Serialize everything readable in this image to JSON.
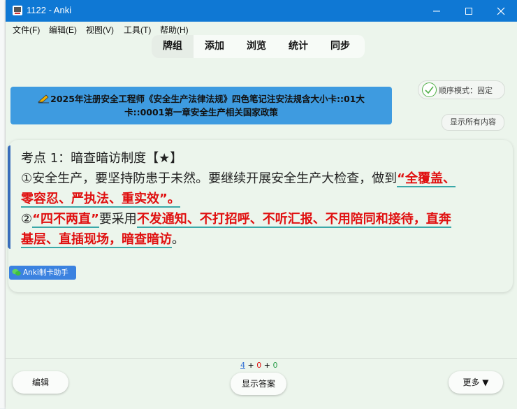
{
  "window": {
    "title": "1122 - Anki"
  },
  "menu": [
    "文件(F)",
    "编辑(E)",
    "视图(V)",
    "工具(T)",
    "帮助(H)"
  ],
  "tabs": [
    "牌组",
    "添加",
    "浏览",
    "统计",
    "同步"
  ],
  "order_mode": "顺序模式：固定",
  "show_all": "显示所有内容",
  "deck": {
    "line1": "2025年注册安全工程师《安全生产法律法规》四色笔记注安法规含大小卡::01大",
    "line2": "卡::0001第一章安全生产相关国家政策"
  },
  "card": {
    "title": "考点 1：暗查暗访制度【★】",
    "p1_plain": "①安全生产，要坚持防患于未然。要继续开展安全生产大检查，做到",
    "p1_red_a": "“全覆盖、",
    "p1_red_b": "零容忍、严执法、重实效”。",
    "p2_red_a": "“四不两直”",
    "p2_plain": "要采用",
    "p2_red_b": "不发通知、不打招呼、不听汇报、不用陪同和接待，直奔",
    "p2_red_c": "基层、直插现场，暗查暗访",
    "p2_end": "。"
  },
  "helper_tag": "Anki制卡助手",
  "counts": {
    "new": "4",
    "plus1": "+",
    "learn": "0",
    "plus2": "+",
    "review": "0"
  },
  "bottom": {
    "edit": "编辑",
    "show_answer": "显示答案",
    "more": "更多 ▼"
  },
  "colors": {
    "titlebar": "#0f78d4",
    "count_new": "#2f6fd6",
    "count_learn": "#e01010",
    "count_review": "#2a9d4a",
    "highlight_red": "#e01010"
  }
}
